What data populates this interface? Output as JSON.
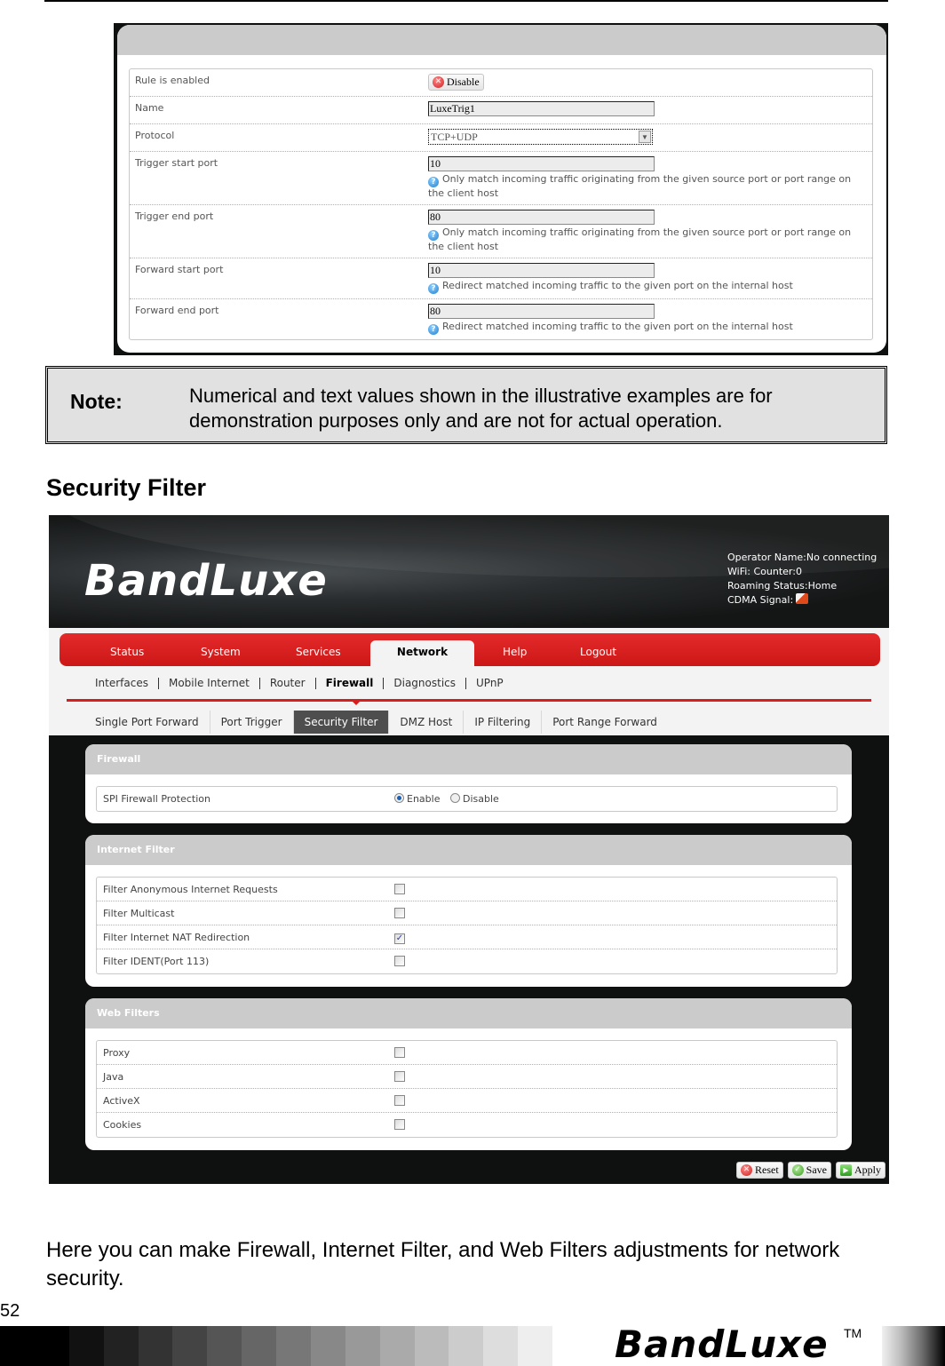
{
  "port_trigger_form": {
    "rows": [
      {
        "label": "Rule is enabled",
        "type": "button",
        "value": "Disable"
      },
      {
        "label": "Name",
        "type": "text",
        "value": "LuxeTrig1"
      },
      {
        "label": "Protocol",
        "type": "select",
        "value": "TCP+UDP"
      },
      {
        "label": "Trigger start port",
        "type": "text",
        "value": "10",
        "hint": "Only match incoming traffic originating from the given source port or port range on the client host"
      },
      {
        "label": "Trigger end port",
        "type": "text",
        "value": "80",
        "hint": "Only match incoming traffic originating from the given source port or port range on the client host"
      },
      {
        "label": "Forward start port",
        "type": "text",
        "value": "10",
        "hint": "Redirect matched incoming traffic to the given port on the internal host"
      },
      {
        "label": "Forward end port",
        "type": "text",
        "value": "80",
        "hint": "Redirect matched incoming traffic to the given port on the internal host"
      }
    ]
  },
  "note": {
    "label": "Note:",
    "text": "Numerical and text values shown in the illustrative examples are for demonstration purposes only and are not for actual operation."
  },
  "section_title": "Security Filter",
  "router_ui": {
    "logo": "BandLuxe",
    "status": {
      "operator": "Operator Name:No connecting",
      "wifi": "WiFi: Counter:0",
      "roaming": "Roaming Status:Home",
      "signal_label": "CDMA Signal:"
    },
    "main_tabs": [
      "Status",
      "System",
      "Services",
      "Network",
      "Help",
      "Logout"
    ],
    "main_active": "Network",
    "sub_tabs": [
      "Interfaces",
      "Mobile Internet",
      "Router",
      "Firewall",
      "Diagnostics",
      "UPnP"
    ],
    "sub_active": "Firewall",
    "third_tabs": [
      "Single Port Forward",
      "Port Trigger",
      "Security Filter",
      "DMZ Host",
      "IP Filtering",
      "Port Range Forward"
    ],
    "third_active": "Security Filter",
    "firewall": {
      "title": "Firewall",
      "row_label": "SPI Firewall Protection",
      "options": [
        "Enable",
        "Disable"
      ],
      "selected": "Enable"
    },
    "internet_filter": {
      "title": "Internet Filter",
      "rows": [
        {
          "label": "Filter Anonymous Internet Requests",
          "checked": false
        },
        {
          "label": "Filter Multicast",
          "checked": false
        },
        {
          "label": "Filter Internet NAT Redirection",
          "checked": true
        },
        {
          "label": "Filter IDENT(Port 113)",
          "checked": false
        }
      ]
    },
    "web_filters": {
      "title": "Web Filters",
      "rows": [
        {
          "label": "Proxy",
          "checked": false
        },
        {
          "label": "Java",
          "checked": false
        },
        {
          "label": "ActiveX",
          "checked": false
        },
        {
          "label": "Cookies",
          "checked": false
        }
      ]
    },
    "actions": {
      "reset": "Reset",
      "save": "Save",
      "apply": "Apply"
    }
  },
  "description": "Here you can make Firewall, Internet Filter, and Web Filters adjustments for network security.",
  "footer": {
    "page_number": "52",
    "brand": "BandLuxe",
    "trademark": "TM",
    "grayscale": [
      "#000000",
      "#000000",
      "#111111",
      "#222222",
      "#333333",
      "#444444",
      "#555555",
      "#666666",
      "#777777",
      "#888888",
      "#999999",
      "#aaaaaa",
      "#bbbbbb",
      "#cccccc",
      "#dddddd",
      "#eeeeee"
    ]
  }
}
